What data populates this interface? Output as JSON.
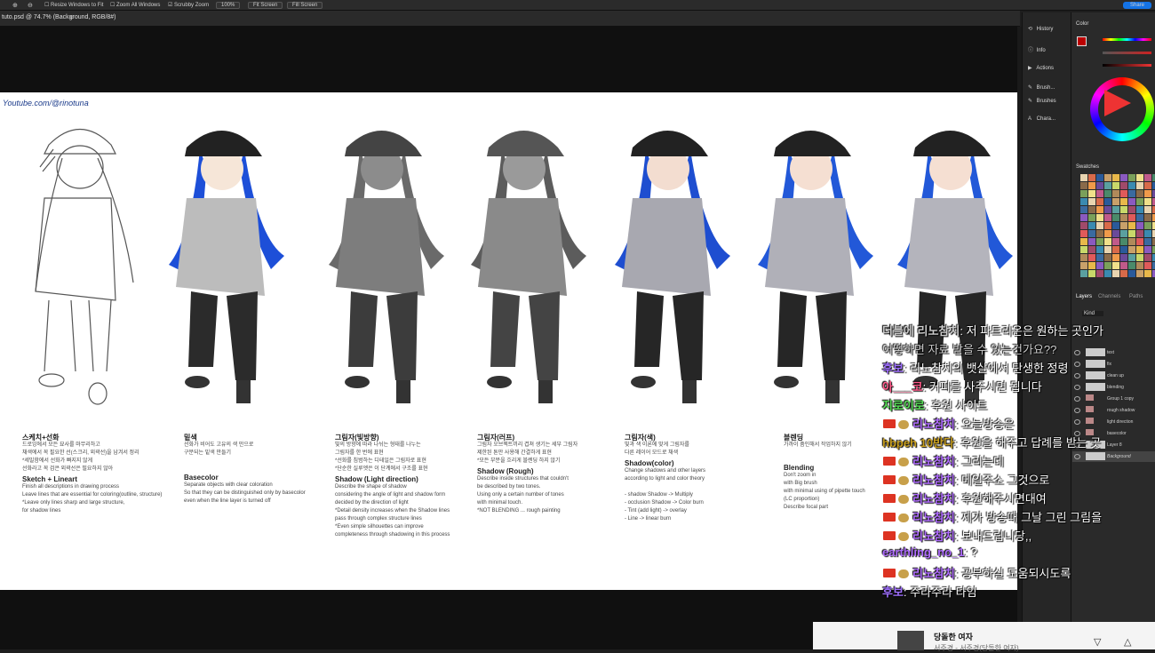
{
  "options_bar": {
    "resize_label": "Resize Windows to Fit",
    "zoom_all_label": "Zoom All Windows",
    "scrubby_label": "Scrubby Zoom",
    "zoom_value": "100%",
    "fit_screen_label": "Fit Screen",
    "fill_screen_label": "Fill Screen",
    "share_label": "Share"
  },
  "document": {
    "tab_title": "tuto.psd @ 74.7% (Background, RGB/8#)",
    "close": "×"
  },
  "canvas": {
    "watermark": "Youtube.com/@rinotuna",
    "columns": [
      {
        "ko": "스케치+선화",
        "ko_body": "드로잉에서 모든 묘사를 마무리하고\n채색에서 꼭 필요한 선(스크리, 외곽선)을 남겨서 정리",
        "ko_red": "*세밀함에서 선화가 빠지지 않게\n선화라고 꼭 검은 외곽선은 필요하지 않아",
        "en": "Sketch + Lineart",
        "en_body": "Finish all descriptions in drawing process\nLeave lines that are essential for coloring(outline, structure)",
        "en_red": "*Leave only lines sharp and large structure,\nfor shadow lines"
      },
      {
        "ko": "밑색",
        "ko_body": "선화가 비어도 고유의 색 만으로\n구분되는 밑색 만들기",
        "ko_red": "",
        "en": "Basecolor",
        "en_body": "Separate objects with clear coloration\nSo that they can be distinguished only by basecolor\neven when the line layer is turned off",
        "en_red": ""
      },
      {
        "ko": "그림자(빛방향)",
        "ko_body": "빛의 방향에 따라 나뉘는 형태를 나누는\n그림자를 한 번에 표현",
        "ko_red": "*선화를 침범하는 디테일은 그림자로 표현\n*단순한 실루엣은 이 단계에서 구조를 표현",
        "en": "Shadow (Light direction)",
        "en_body": "Describe the shape of shadow\nconsidering the angle of light and shadow form\ndecided by the direction of light",
        "en_red": "*Detail density increases when the Shadow lines\npass through complex structure lines\n*Even simple silhouettes can improve\ncompleteness through shadowing in this process"
      },
      {
        "ko": "그림자(러프)",
        "ko_body": "그림자 오브젝트끼리 겹쳐 생기는 세부 그림자\n제한된 톤만 사용해 간결하게 표현",
        "ko_red": "*모든 부분을 흐리게 블렌딩 하지 않기",
        "en": "Shadow (Rough)",
        "en_body": "Describe inside structures that couldn't\nbe described by two tones.\nUsing only a certain number of tones\nwith minimal touch.",
        "en_red": "*NOT BLENDING ... rough painting"
      },
      {
        "ko": "그림자(색)",
        "ko_body": "빛과 색 이론에 맞게 그림자를\n다른 레이어 모드로 채색",
        "ko_red": "",
        "en": "Shadow(color)",
        "en_body": "Change shadows and other layers\naccording to light and color theory\n\n- shadow Shadow -> Multiply\n- occlusion Shadow -> Color burn\n- Tint (add light) -> overlay\n- Line -> linear burn",
        "en_red": ""
      },
      {
        "ko": "블렌딩",
        "ko_body": "가까이 줌인해서 작업하지 않기",
        "ko_red": "",
        "en": "Blending",
        "en_body": "Don't zoom in\nwith Big brush\nwith minimal using of pipette touch\n(LC proportion)\nDescribe focal part",
        "en_red": ""
      }
    ]
  },
  "right_icons": [
    "History",
    "Info",
    "Actions",
    "Brush...",
    "Brushes",
    "Chara..."
  ],
  "panels": {
    "color": "Color",
    "swatches": "Swatches",
    "layers_tab": "Layers",
    "channels_tab": "Channels",
    "paths_tab": "Paths",
    "kind_label": "Kind"
  },
  "layers": [
    "text",
    "fix",
    "clean up",
    "blending",
    "Group 1 copy",
    "rough shadow",
    "light direction",
    "basecolor",
    "Layer 8",
    "Background"
  ],
  "chat": [
    {
      "user": "더블에 리노참치",
      "text": "저 파트리온은 원하는 곳인가",
      "color": "#ccc",
      "badge": false
    },
    {
      "user": "",
      "text": "어떻하면 자료 받을 수 있는건가요??",
      "color": "#ccc",
      "badge": false
    },
    {
      "user": "후보",
      "text": "리노참치의 뱃살에서 탄생한 정령",
      "color": "#a070ff",
      "badge": false
    },
    {
      "user": "아___코",
      "text": "커피를 사주시면 됩니다",
      "color": "#ff5a8a",
      "badge": false
    },
    {
      "user": "지로이로",
      "text": "후원 사이트",
      "color": "#55dd55",
      "badge": false
    },
    {
      "user": "리노참치",
      "text": "오늘방송은",
      "color": "#b06cff",
      "badge": true
    },
    {
      "user": "hbpeh 10반다",
      "text": "후원을 해주고 답례를 받는 곳",
      "color": "#c9a020",
      "badge": false
    },
    {
      "user": "리노참치",
      "text": "그리는데",
      "color": "#b06cff",
      "badge": true
    },
    {
      "user": "리노참치",
      "text": "메일주소 그것으로",
      "color": "#b06cff",
      "badge": true
    },
    {
      "user": "리노참치",
      "text": "후원해주시면대여",
      "color": "#b06cff",
      "badge": true
    },
    {
      "user": "리노참치",
      "text": "제가 방송때 그날 그린 그림을",
      "color": "#b06cff",
      "badge": true
    },
    {
      "user": "리노참치",
      "text": "보내드립니당,,",
      "color": "#b06cff",
      "badge": true
    },
    {
      "user": "earthling_no_1",
      "text": "?",
      "color": "#b06cff",
      "badge": false
    },
    {
      "user": "리노참치",
      "text": "공부하실 도움되시도록",
      "color": "#b06cff",
      "badge": true
    },
    {
      "user": "후보",
      "text": "주라주라 타임",
      "color": "#a070ff",
      "badge": false
    }
  ],
  "music": {
    "title": "당돌한 여자",
    "artist": "서주경 - 서주경(당돌한 여자)"
  }
}
